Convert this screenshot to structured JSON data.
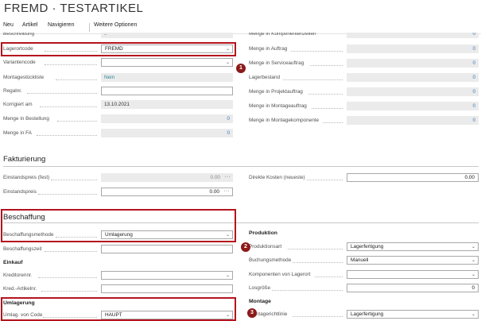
{
  "page_title": "FREMD · TESTARTIKEL",
  "menu": {
    "neu": "Neu",
    "artikel": "Artikel",
    "navigieren": "Navigieren",
    "weitere": "Weitere Optionen"
  },
  "general": {
    "beschreibung_label": "Beschreibung",
    "beschreibung_value": "..",
    "lagerortcode_label": "Lagerortcode",
    "lagerortcode_value": "FREMD",
    "variantencode_label": "Variantencode",
    "variantencode_value": "",
    "montage_label": "Montagestückliste",
    "montage_value": "Nein",
    "regalnr_label": "Regalnr.",
    "regalnr_value": "",
    "korrigiert_label": "Korrigiert am",
    "korrigiert_value": "13.10.2021",
    "bestellung_label": "Menge in Bestellung",
    "bestellung_value": "0",
    "fa_label": "Menge in FA",
    "fa_value": "0"
  },
  "general_right": {
    "komp_label": "Menge in Komponentenzeilen",
    "komp_value": "0",
    "auftrag_label": "Menge in Auftrag",
    "auftrag_value": "0",
    "service_label": "Menge in Serviceauftrag",
    "service_value": "0",
    "lagerbestand_label": "Lagerbestand",
    "lagerbestand_value": "0",
    "projekt_label": "Menge in Projektauftrag",
    "projekt_value": "0",
    "montageauftrag_label": "Menge in Montageauftrag",
    "montageauftrag_value": "0",
    "montagekomp_label": "Menge in Montagekomponente",
    "montagekomp_value": "0"
  },
  "fakturierung": {
    "title": "Fakturierung",
    "einstand_fest_label": "Einstandspreis (fest)",
    "einstand_fest_value": "0.00",
    "einstand_label": "Einstandspreis",
    "einstand_value": "0.00",
    "direkte_label": "Direkte Kosten (neueste)",
    "direkte_value": "0.00"
  },
  "beschaffung": {
    "title": "Beschaffung",
    "methode_label": "Beschaffungsmethode",
    "methode_value": "Umlagerung",
    "zeit_label": "Beschaffungszeit",
    "zeit_value": "",
    "einkauf_title": "Einkauf",
    "kreditor_label": "Kreditorennr.",
    "kreditor_value": "",
    "kred_artikel_label": "Kred.-Artikelnr.",
    "kred_artikel_value": "",
    "umlagerung_title": "Umlagerung",
    "umlag_von_label": "Umlag. von Code",
    "umlag_von_value": "HAUPT"
  },
  "produktion": {
    "title": "Produktion",
    "art_label": "Produktionsart",
    "art_value": "Lagerfertigung",
    "buchung_label": "Buchungsmethode",
    "buchung_value": "Manuell",
    "komp_lagerort_label": "Komponenten von Lagerort",
    "komp_lagerort_value": "",
    "losgroesse_label": "Losgröße",
    "losgroesse_value": "0",
    "montage_title": "Montage",
    "montagerichtlinie_label": "Montagerichtlinie",
    "montagerichtlinie_value": "Lagerfertigung"
  },
  "markers": {
    "m1": "1",
    "m2": "2",
    "m3": "3"
  },
  "icons": {
    "chevron": "chevron-down-icon",
    "ellipsis": "ellipsis-icon"
  },
  "colors": {
    "highlight": "#b4141e",
    "marker": "#8c1a1a",
    "readonly_bg": "#ebebeb",
    "link_blue": "#3c7bbd",
    "teal": "#2e8a9a"
  }
}
